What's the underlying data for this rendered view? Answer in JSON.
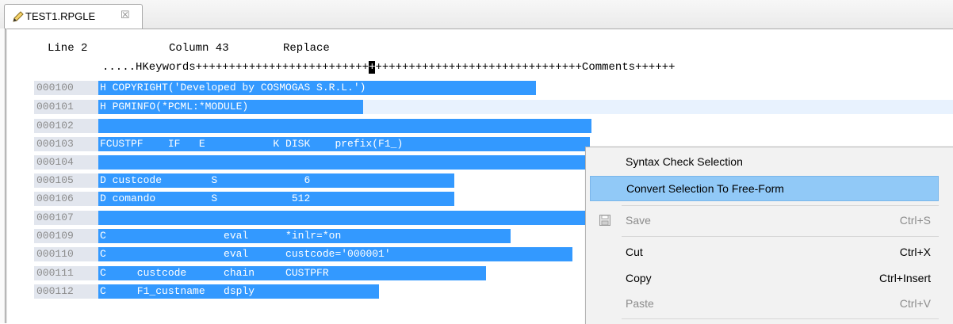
{
  "tab": {
    "title": "TEST1.RPGLE",
    "close": "☒"
  },
  "status": {
    "line": "Line 2",
    "column": "Column 43",
    "mode": "Replace"
  },
  "ruler": {
    "before": ".....HKeywords++++++++++++++++++++++++++",
    "cursor": "+",
    "after": "+++++++++++++++++++++++++++++++Comments++++++"
  },
  "lines": [
    {
      "no": "000100",
      "code": "H COPYRIGHT('Developed by COSMOGAS S.R.L.')"
    },
    {
      "no": "000101",
      "code": "H PGMINFO(*PCML:*MODULE)"
    },
    {
      "no": "000102",
      "code": ""
    },
    {
      "no": "000103",
      "code": "FCUSTPF    IF   E           K DISK    prefix(F1_)"
    },
    {
      "no": "000104",
      "code": ""
    },
    {
      "no": "000105",
      "code": "D custcode        S              6"
    },
    {
      "no": "000106",
      "code": "D comando         S            512"
    },
    {
      "no": "000107",
      "code": ""
    },
    {
      "no": "000109",
      "code": "C                   eval      *inlr=*on"
    },
    {
      "no": "000110",
      "code": "C                   eval      custcode='000001'"
    },
    {
      "no": "000111",
      "code": "C     custcode      chain     CUSTPFR"
    },
    {
      "no": "000112",
      "code": "C     F1_custname   dsply"
    }
  ],
  "menu": {
    "syntax_check": "Syntax Check Selection",
    "convert": "Convert Selection To Free-Form",
    "save": "Save",
    "save_shortcut": "Ctrl+S",
    "cut": "Cut",
    "cut_shortcut": "Ctrl+X",
    "copy": "Copy",
    "copy_shortcut": "Ctrl+Insert",
    "paste": "Paste",
    "paste_shortcut": "Ctrl+V"
  },
  "colors": {
    "selection": "#3399ff",
    "menu_highlight": "#91c9f7",
    "current_line": "#e8f2fe"
  }
}
